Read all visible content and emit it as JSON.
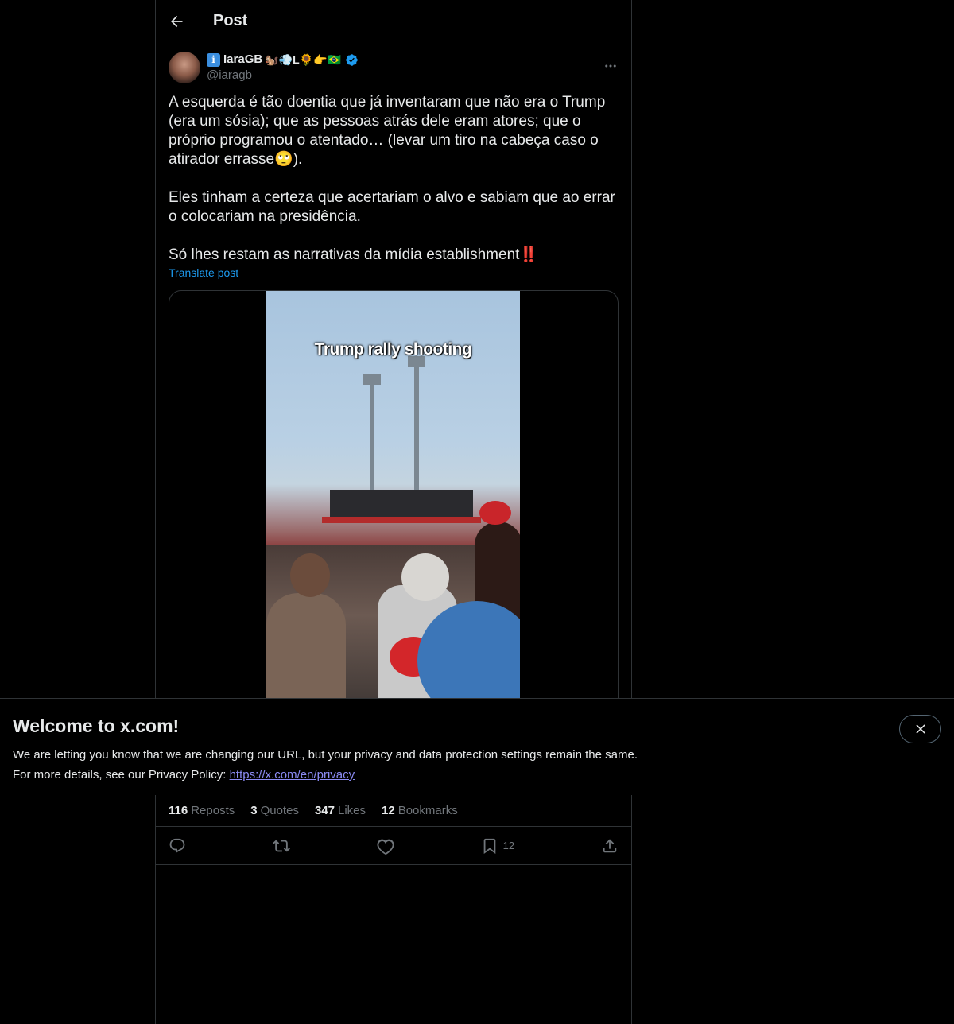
{
  "header": {
    "title": "Post"
  },
  "author": {
    "badge_letter": "i",
    "name": "IaraGB",
    "emoji_suffix": "🐿️💨L🌻👉🇧🇷",
    "handle": "@iaragb"
  },
  "post": {
    "text": "A esquerda é tão doentia que já inventaram que não era o Trump (era um sósia); que as pessoas atrás dele eram atores; que o próprio programou o atentado… (levar um tiro na cabeça caso o atirador errasse🙄).\n\nEles tinham a certeza que acertariam o alvo e sabiam que ao errar o colocariam na presidência.\n\nSó lhes restam as narrativas da mídia establishment‼️",
    "translate_label": "Translate post"
  },
  "media": {
    "caption": "Trump rally shooting"
  },
  "stats": {
    "reposts_count": "116",
    "reposts_label": "Reposts",
    "quotes_count": "3",
    "quotes_label": "Quotes",
    "likes_count": "347",
    "likes_label": "Likes",
    "bookmarks_count": "12",
    "bookmarks_label": "Bookmarks"
  },
  "actions": {
    "bookmark_count": "12"
  },
  "banner": {
    "title": "Welcome to x.com!",
    "line1": "We are letting you know that we are changing our URL, but your privacy and data protection settings remain the same.",
    "line2_prefix": "For more details, see our Privacy Policy: ",
    "link": "https://x.com/en/privacy"
  },
  "colors": {
    "accent": "#1d9bf0",
    "border": "#2f3336",
    "muted": "#71767b",
    "text": "#e7e9ea"
  }
}
